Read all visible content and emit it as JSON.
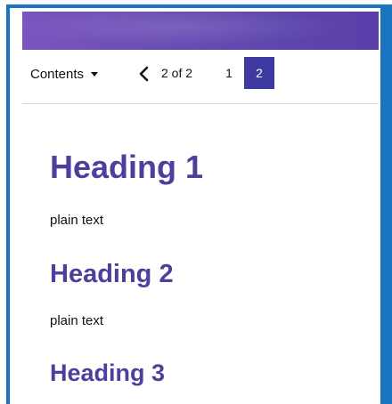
{
  "colors": {
    "banner": "#6b4eb5",
    "frame": "#1b74c0",
    "heading": "#4d3f9b",
    "active_page": "#3f3aa0"
  },
  "toolbar": {
    "contents_label": "Contents",
    "contents_icon": "caret-down-icon",
    "prev_icon": "chevron-left-icon",
    "page_count": "2 of 2",
    "pages": [
      {
        "label": "1",
        "active": false
      },
      {
        "label": "2",
        "active": true
      }
    ]
  },
  "content": {
    "heading1": "Heading 1",
    "text1": "plain text",
    "heading2": "Heading 2",
    "text2": "plain text",
    "heading3": "Heading 3"
  }
}
